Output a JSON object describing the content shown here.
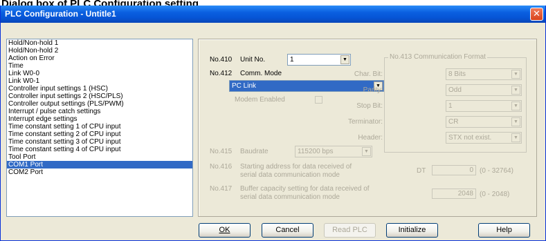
{
  "caption": "Dialog box of PLC Configuration setting",
  "window": {
    "title": "PLC Configuration - Untitle1",
    "close_glyph": "✕"
  },
  "list": {
    "items": [
      "Hold/Non-hold 1",
      "Hold/Non-hold 2",
      "Action on Error",
      "Time",
      "Link W0-0",
      "Link W0-1",
      "Controller input settings 1 (HSC)",
      "Controller input settings 2 (HSC/PLS)",
      "Controller output settings (PLS/PWM)",
      "Interrupt / pulse catch settings",
      "Interrupt edge settings",
      "Time constant setting 1 of CPU input",
      "Time constant setting 2 of CPU input",
      "Time constant setting 3 of CPU input",
      "Time constant setting 4 of CPU input",
      "Tool Port",
      "COM1 Port",
      "COM2 Port"
    ],
    "selected": "COM1 Port"
  },
  "settings": {
    "no410": {
      "number": "No.410",
      "label": "Unit No.",
      "value": "1"
    },
    "no412": {
      "number": "No.412",
      "label": "Comm. Mode",
      "value": "PC Link"
    },
    "modem": {
      "label": "Modem Enabled",
      "checked": false
    },
    "no413": {
      "legend": "No.413 Communication Format",
      "char_bit": {
        "label": "Char. Bit:",
        "value": "8 Bits"
      },
      "parity": {
        "label": "Parity:",
        "value": "Odd"
      },
      "stop_bit": {
        "label": "Stop Bit:",
        "value": "1"
      },
      "terminator": {
        "label": "Terminator:",
        "value": "CR"
      },
      "header": {
        "label": "Header:",
        "value": "STX not exist."
      }
    },
    "no415": {
      "number": "No.415",
      "label": "Baudrate",
      "value": "115200 bps"
    },
    "no416": {
      "number": "No.416",
      "line1": "Starting address for data received of",
      "line2": "serial data communication mode",
      "prefix": "DT",
      "value": "0",
      "range": "(0 - 32764)"
    },
    "no417": {
      "number": "No.417",
      "line1": "Buffer capacity setting for data received of",
      "line2": "serial data communication mode",
      "value": "2048",
      "range": "(0 - 2048)"
    }
  },
  "buttons": {
    "ok": "OK",
    "cancel": "Cancel",
    "read_plc": "Read PLC",
    "initialize": "Initialize",
    "help": "Help"
  },
  "colors": {
    "titlebar": "#0a5fe0",
    "selection": "#316ac5",
    "dialog_face": "#ece9d8",
    "disabled_text": "#aca899"
  },
  "icons": {
    "dropdown": "chevron-down-icon",
    "close": "close-icon"
  }
}
